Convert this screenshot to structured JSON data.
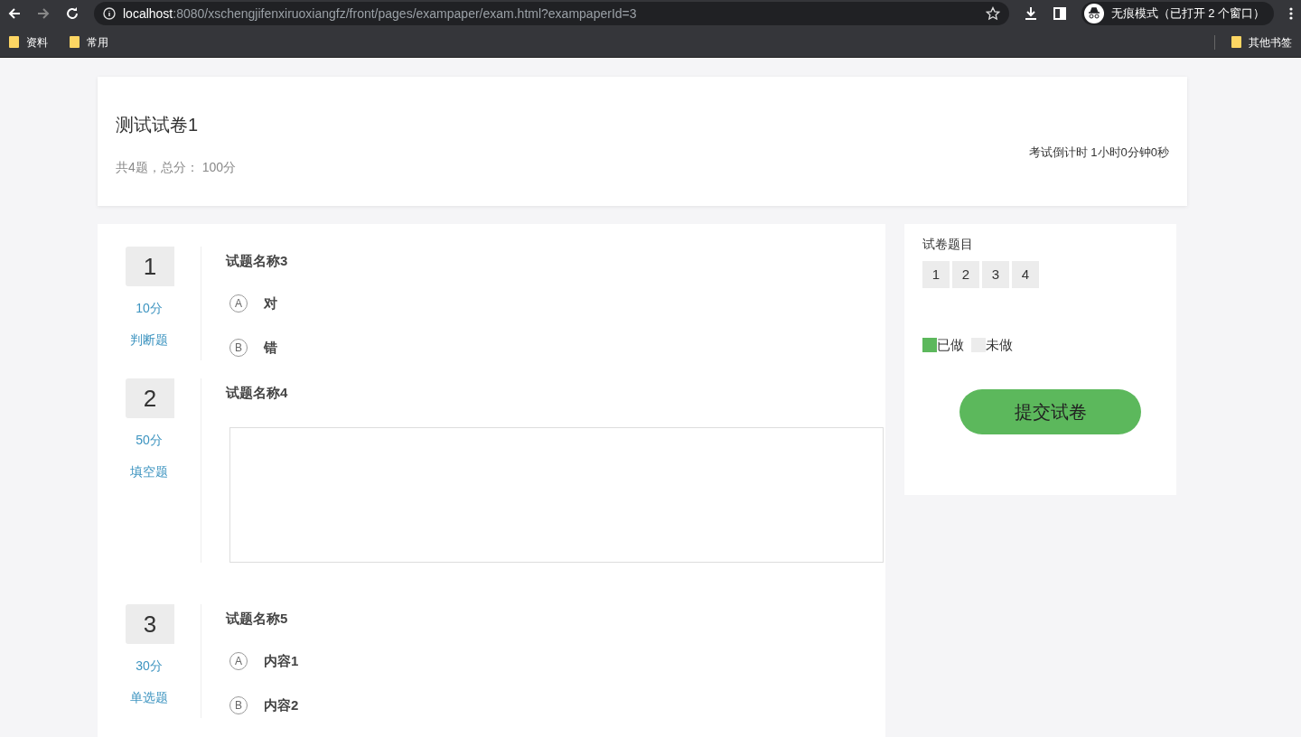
{
  "browser": {
    "url_host": "localhost",
    "url_rest": ":8080/xschengjifenxiruoxiangfz/front/pages/exampaper/exam.html?exampaperId=3",
    "incognito_label": "无痕模式（已打开 2 个窗口）",
    "bookmarks": [
      "资料",
      "常用"
    ],
    "other_bookmarks": "其他书签"
  },
  "header": {
    "title": "测试试卷1",
    "summary": "共4题，总分： 100分",
    "countdown": "考试倒计时 1小时0分钟0秒"
  },
  "questions": [
    {
      "number": "1",
      "score": "10分",
      "type_label": "判断题",
      "title": "试题名称3",
      "kind": "choice",
      "options": [
        {
          "letter": "A",
          "text": "对",
          "selected": false
        },
        {
          "letter": "B",
          "text": "错",
          "selected": false
        }
      ]
    },
    {
      "number": "2",
      "score": "50分",
      "type_label": "填空题",
      "title": "试题名称4",
      "kind": "text"
    },
    {
      "number": "3",
      "score": "30分",
      "type_label": "单选题",
      "title": "试题名称5",
      "kind": "choice",
      "options": [
        {
          "letter": "A",
          "text": "内容1",
          "selected": false
        },
        {
          "letter": "B",
          "text": "内容2",
          "selected": false
        }
      ]
    }
  ],
  "sidebar": {
    "title": "试卷题目",
    "items": [
      {
        "label": "1",
        "done": false
      },
      {
        "label": "2",
        "done": false
      },
      {
        "label": "3",
        "done": false
      },
      {
        "label": "4",
        "done": false
      }
    ],
    "legend": [
      {
        "label": "已做",
        "color": "#5cb85c"
      },
      {
        "label": "未做",
        "color": "#ececec"
      }
    ],
    "submit": "提交试卷"
  }
}
